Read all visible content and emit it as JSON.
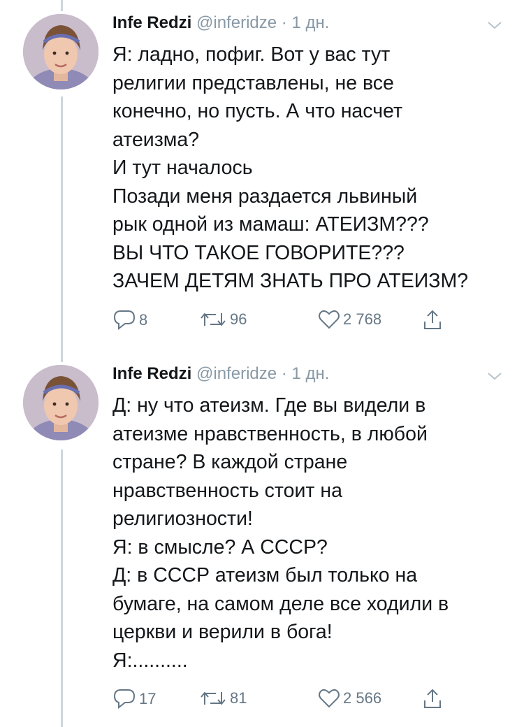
{
  "tweets": [
    {
      "author_name": "Infe Redzi",
      "handle": "@inferidze",
      "separator": "·",
      "time": "1 дн.",
      "lines": [
        "Я: ладно, пофиг. Вот у вас тут",
        "религии представлены, не все",
        "конечно, но пусть. А что насчет",
        "атеизма?",
        "И тут началось",
        "Позади меня раздается львиный",
        "рык одной из мамаш: АТЕИЗМ???",
        "ВЫ ЧТО ТАКОЕ ГОВОРИТЕ???",
        "ЗАЧЕМ ДЕТЯМ ЗНАТЬ ПРО АТЕИЗМ?"
      ],
      "reply_count": "8",
      "retweet_count": "96",
      "like_count": "2 768"
    },
    {
      "author_name": "Infe Redzi",
      "handle": "@inferidze",
      "separator": "·",
      "time": "1 дн.",
      "lines": [
        "Д: ну что атеизм. Где вы видели в",
        "атеизме нравственность, в любой",
        "стране? В каждой стране",
        "нравственность стоит на",
        "религиозности!",
        "Я: в смысле? А СССР?",
        "Д: в СССР атеизм был только на",
        "бумаге, на самом деле все ходили в",
        "церкви и верили в бога!",
        "Я:.........."
      ],
      "reply_count": "17",
      "retweet_count": "81",
      "like_count": "2 566"
    }
  ],
  "colors": {
    "text": "#14171a",
    "secondary": "#8899a6",
    "icon": "#657786",
    "thread_line": "#ccd6dd"
  },
  "icons": [
    "reply-icon",
    "retweet-icon",
    "like-icon",
    "share-icon",
    "chevron-down-icon"
  ]
}
